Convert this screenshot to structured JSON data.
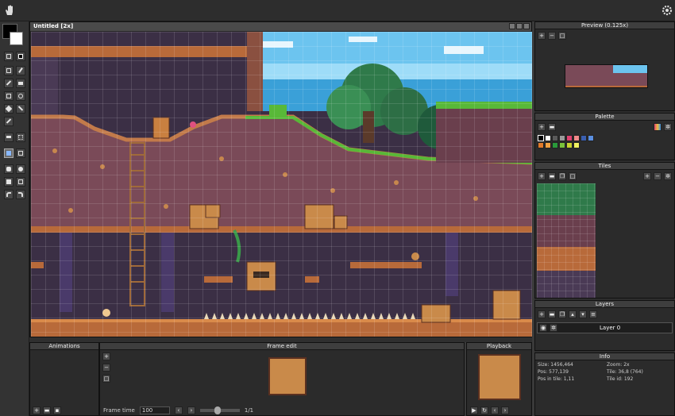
{
  "document": {
    "title": "Untitled  [2x]"
  },
  "preview": {
    "title": "Preview (0.125x)"
  },
  "palette": {
    "title": "Palette",
    "colors": [
      "#000000",
      "#ffffff",
      "#5a5a5a",
      "#9a9a9a",
      "#e04070",
      "#f08a8a",
      "#3a5fb0",
      "#5b8fe0",
      "#e07a2a",
      "#f0a040",
      "#2a9a3a",
      "#7ac03a",
      "#c8d030",
      "#f0f060"
    ]
  },
  "tiles": {
    "title": "Tiles"
  },
  "layers": {
    "title": "Layers",
    "items": [
      {
        "name": "Layer 0"
      }
    ]
  },
  "info": {
    "title": "Info",
    "size": "Size: 1456,464",
    "zoom": "Zoom: 2x",
    "pos": "Pos: 577,139",
    "tile": "Tile: 36,8 (764)",
    "pos_in_tile": "Pos in tile: 1,11",
    "tile_id": "Tile id: 192"
  },
  "animations": {
    "title": "Animations"
  },
  "frame_edit": {
    "title": "Frame edit"
  },
  "playback": {
    "title": "Playback"
  },
  "bottom": {
    "frame_time_label": "Frame time",
    "frame_time_value": "100",
    "frame_counter": "1/1"
  },
  "colors": {
    "sky": "#58b8e8",
    "dirt": "#7a4a58",
    "dirt_dark": "#5e3745",
    "brick": "#b86a3a",
    "grass": "#58b838",
    "cave": "#3b2f45"
  }
}
